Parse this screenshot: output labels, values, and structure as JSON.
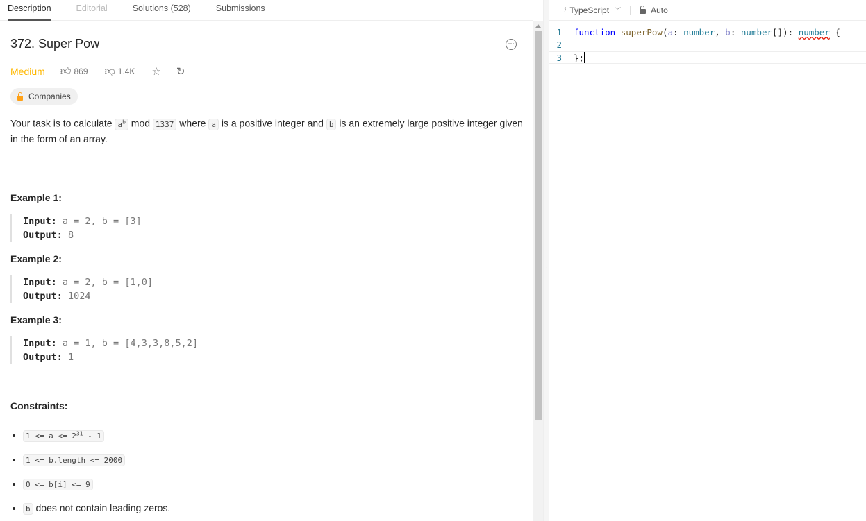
{
  "tabs": [
    {
      "label": "Description"
    },
    {
      "label": "Editorial"
    },
    {
      "label": "Solutions (528)"
    },
    {
      "label": "Submissions"
    }
  ],
  "problem": {
    "title": "372. Super Pow",
    "difficulty": "Medium",
    "likes": "869",
    "dislikes": "1.4K",
    "companies": "Companies",
    "desc1": "Your task is to calculate ",
    "code_a": "a",
    "code_b_sup": "b",
    "desc2": " mod ",
    "code_1337": "1337",
    "desc3": " where ",
    "desc4": " is a positive integer and ",
    "code_b": "b",
    "desc5": " is an extremely large positive integer given in the form of an array."
  },
  "examples": [
    {
      "title": "Example 1:",
      "input_label": "Input:",
      "input": " a = 2, b = [3]",
      "output_label": "Output:",
      "output": " 8"
    },
    {
      "title": "Example 2:",
      "input_label": "Input:",
      "input": " a = 2, b = [1,0]",
      "output_label": "Output:",
      "output": " 1024"
    },
    {
      "title": "Example 3:",
      "input_label": "Input:",
      "input": " a = 1, b = [4,3,3,8,5,2]",
      "output_label": "Output:",
      "output": " 1"
    }
  ],
  "constraints": {
    "title": "Constraints:",
    "c1_pre": "1 <= a <= 2",
    "c1_sup": "31",
    "c1_post": " - 1",
    "c2": "1 <= b.length <= 2000",
    "c3": "0 <= b[i] <= 9",
    "c4_code": "b",
    "c4_text": " does not contain leading zeros."
  },
  "editor": {
    "language": "TypeScript",
    "mode": "Auto",
    "lines": [
      "1",
      "2",
      "3"
    ],
    "t_function": "function",
    "t_name": " superPow",
    "t_p1": "(",
    "t_a": "a",
    ":": ": ",
    "t_number": "number",
    "t_comma": ", ",
    "t_b": "b",
    "t_numarr": "number",
    "t_brk": "[]): ",
    "t_ret": "number",
    "t_open": " {",
    "t_close": "};"
  }
}
